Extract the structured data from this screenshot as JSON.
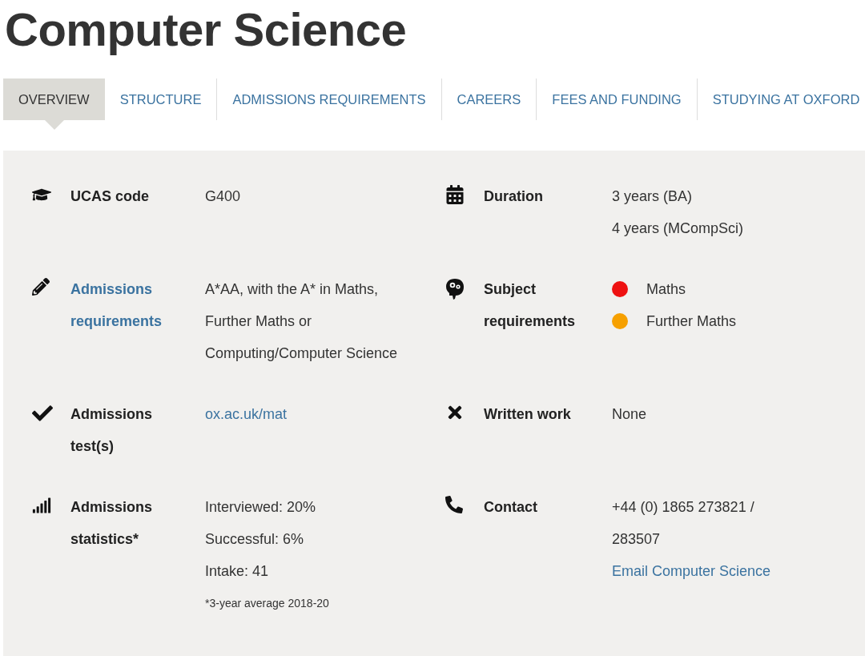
{
  "title": "Computer Science",
  "tabs": [
    {
      "label": "OVERVIEW",
      "selected": true
    },
    {
      "label": "STRUCTURE",
      "selected": false
    },
    {
      "label": "ADMISSIONS REQUIREMENTS",
      "selected": false
    },
    {
      "label": "CAREERS",
      "selected": false
    },
    {
      "label": "FEES AND FUNDING",
      "selected": false
    },
    {
      "label": "STUDYING AT OXFORD",
      "selected": false
    }
  ],
  "facts": [
    {
      "label": {
        "kind": "plain",
        "text": "UCAS code"
      },
      "values": [
        {
          "kind": "text",
          "text": "G400"
        }
      ]
    },
    {
      "label": {
        "kind": "plain",
        "text": "Duration"
      },
      "values": [
        {
          "kind": "text",
          "text": "3 years (BA)"
        },
        {
          "kind": "text",
          "text": "4 years (MCompSci)"
        }
      ]
    },
    {
      "label": {
        "kind": "link",
        "text": "Admissions requirements"
      },
      "values": [
        {
          "kind": "text",
          "text": "A*AA, with the A* in Maths, Further Maths or Computing/Computer Science"
        }
      ]
    },
    {
      "label": {
        "kind": "plain",
        "text": "Subject requirements"
      },
      "values": [
        {
          "kind": "dot",
          "text": "Maths",
          "color": "#ee1111"
        },
        {
          "kind": "dot",
          "text": "Further Maths",
          "color": "#f6a000"
        }
      ]
    },
    {
      "label": {
        "kind": "plain",
        "text": "Admissions test(s)"
      },
      "values": [
        {
          "kind": "link",
          "text": "ox.ac.uk/mat"
        }
      ]
    },
    {
      "label": {
        "kind": "plain",
        "text": "Written work"
      },
      "values": [
        {
          "kind": "text",
          "text": "None"
        }
      ]
    },
    {
      "label": {
        "kind": "plain",
        "text": "Admissions statistics*"
      },
      "values": [
        {
          "kind": "text",
          "text": "Interviewed: 20%"
        },
        {
          "kind": "text",
          "text": "Successful: 6%"
        },
        {
          "kind": "text",
          "text": "Intake: 41"
        },
        {
          "kind": "note",
          "text": "*3-year average 2018-20"
        }
      ]
    },
    {
      "label": {
        "kind": "plain",
        "text": "Contact"
      },
      "values": [
        {
          "kind": "text",
          "text": "+44 (0) 1865 273821 / 283507"
        },
        {
          "kind": "link",
          "text": "Email Computer Science"
        }
      ]
    }
  ]
}
